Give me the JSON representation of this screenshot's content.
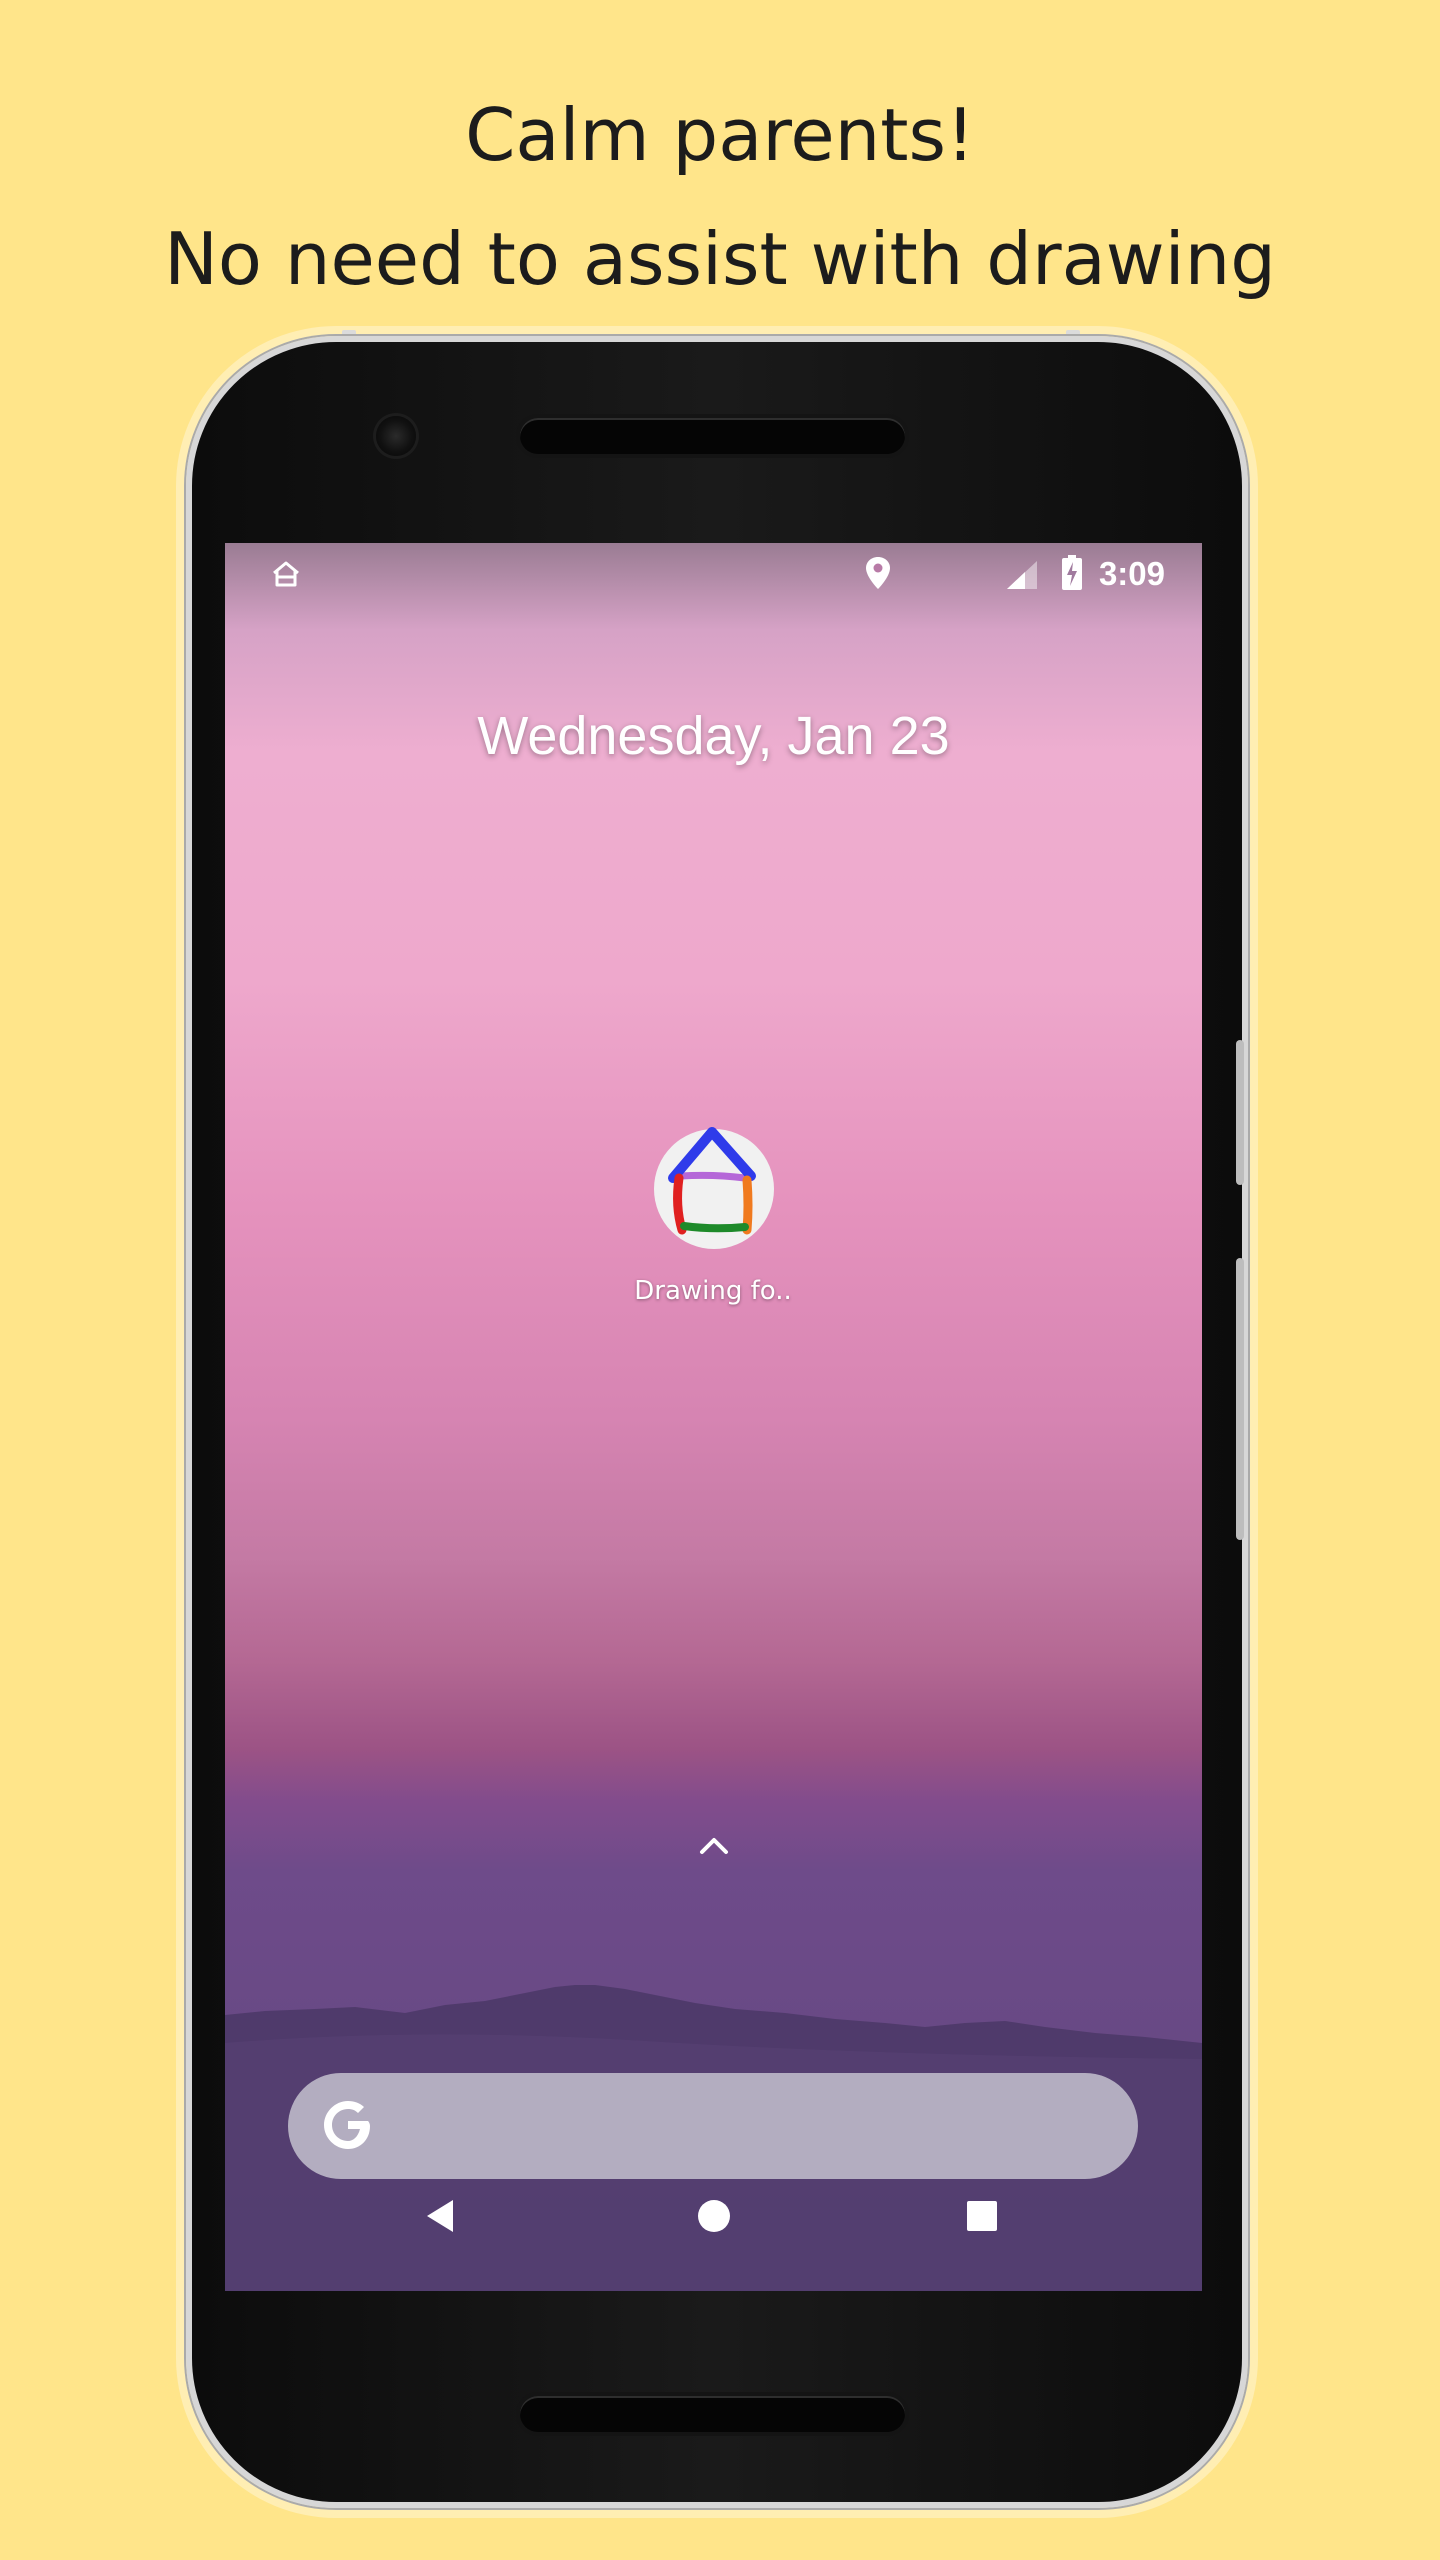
{
  "promo": {
    "line1": "Calm parents!",
    "line2": "No need to assist with drawing"
  },
  "status_bar": {
    "time": "3:09",
    "icons": [
      "home-outline-icon",
      "location-pin-icon",
      "signal-icon",
      "battery-charging-icon"
    ]
  },
  "home_screen": {
    "date": "Wednesday, Jan 23",
    "app": {
      "label": "Drawing fo..",
      "icon": "house-drawing-icon"
    },
    "app_drawer_hint_icon": "chevron-up-icon",
    "search": {
      "logo": "google-g-icon"
    }
  },
  "navigation": {
    "back_icon": "back-triangle-icon",
    "home_icon": "home-circle-icon",
    "recents_icon": "recents-square-icon"
  },
  "colors": {
    "background": "#FFE58A",
    "headline_text": "#1C1C1C",
    "house_roof": "#2F3BEA",
    "house_left_wall": "#E02020",
    "house_right_wall": "#F07A1F",
    "house_floor": "#1E8A2A",
    "house_ceiling": "#B567D8"
  }
}
